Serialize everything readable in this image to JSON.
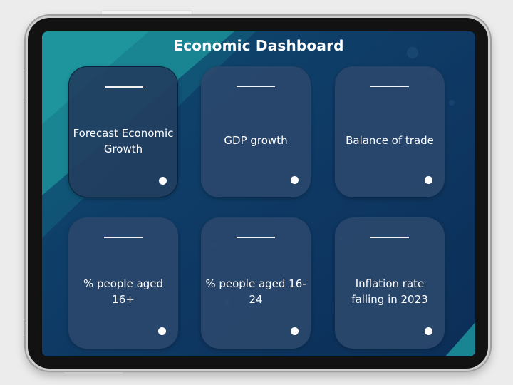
{
  "dashboard": {
    "title": "Economic Dashboard"
  },
  "cards": [
    {
      "label": "Forecast Economic Growth",
      "name": "card-forecast-economic-growth"
    },
    {
      "label": "GDP growth",
      "name": "card-gdp-growth"
    },
    {
      "label": "Balance of trade",
      "name": "card-balance-of-trade"
    },
    {
      "label": "% people aged 16+",
      "name": "card-people-aged-16-plus"
    },
    {
      "label": "% people aged 16-24",
      "name": "card-people-aged-16-24"
    },
    {
      "label": "Inflation rate falling in 2023",
      "name": "card-inflation-rate-falling-2023"
    }
  ],
  "colors": {
    "background": "#0f3a66",
    "accent_teal": "#1d8c94",
    "card": "#2c486c",
    "text": "#ffffff"
  }
}
